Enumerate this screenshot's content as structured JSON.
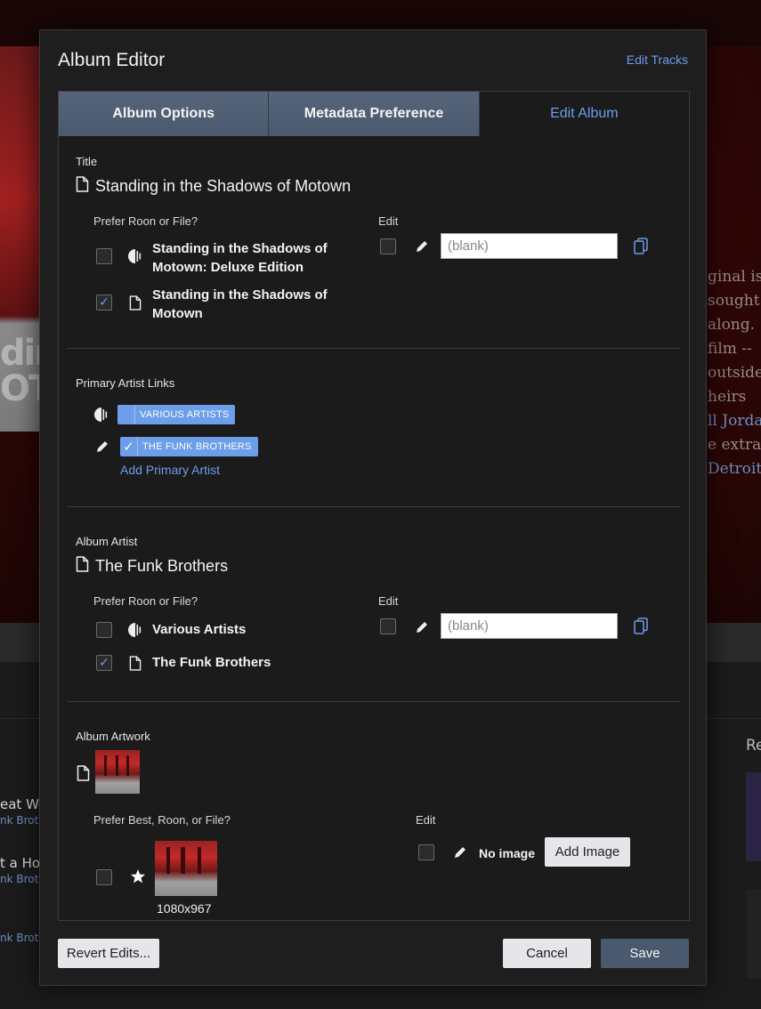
{
  "background": {
    "cover_text": "ding\nOT",
    "prose_lines": [
      "ginal is",
      "sought",
      "along.",
      "film --",
      "outside",
      "heirs",
      "ll Jorda",
      "e extra",
      "Detroit"
    ],
    "left_list": [
      {
        "title": "eat W",
        "subtitle": "nk Brot"
      },
      {
        "title": "t a Hol",
        "subtitle": "nk Brot"
      },
      {
        "title": "",
        "subtitle": "nk Brot"
      }
    ],
    "right_heading": "Re"
  },
  "dialog": {
    "title": "Album Editor",
    "edit_tracks_link": "Edit Tracks",
    "tabs": [
      {
        "label": "Album Options"
      },
      {
        "label": "Metadata Preference"
      },
      {
        "label": "Edit Album"
      }
    ],
    "active_tab": 2,
    "title_section": {
      "label": "Title",
      "value": "Standing in the Shadows of Motown",
      "prefer_label": "Prefer Roon or File?",
      "edit_label": "Edit",
      "options": [
        {
          "source": "roon",
          "line1": "Standing in the Shadows of",
          "line2": "Motown: Deluxe Edition",
          "checked": false
        },
        {
          "source": "file",
          "line1": "Standing in the Shadows of",
          "line2": "Motown",
          "checked": true
        }
      ],
      "edit_checked": false,
      "edit_placeholder": "(blank)"
    },
    "primary_artist": {
      "label": "Primary Artist Links",
      "chips": [
        {
          "source": "roon",
          "label": "VARIOUS ARTISTS",
          "checked": false
        },
        {
          "source": "edit",
          "label": "THE FUNK BROTHERS",
          "checked": true
        }
      ],
      "add_link": "Add Primary Artist"
    },
    "album_artist": {
      "label": "Album Artist",
      "value": "The Funk Brothers",
      "prefer_label": "Prefer Roon or File?",
      "edit_label": "Edit",
      "options": [
        {
          "source": "roon",
          "text": "Various Artists",
          "checked": false
        },
        {
          "source": "file",
          "text": "The Funk Brothers",
          "checked": true
        }
      ],
      "edit_checked": false,
      "edit_placeholder": "(blank)"
    },
    "artwork": {
      "label": "Album Artwork",
      "prefer_label": "Prefer Best, Roon, or File?",
      "edit_label": "Edit",
      "best_checked": false,
      "best_resolution": "1080x967",
      "edit_checked": false,
      "no_image_text": "No image",
      "add_image_button": "Add Image"
    },
    "footer": {
      "revert_button": "Revert Edits...",
      "cancel_button": "Cancel",
      "save_button": "Save"
    }
  },
  "colors": {
    "accent": "#6c9eea",
    "tab_bg": "#4f5e73",
    "dialog_bg": "#1e1e1f",
    "save_bg": "#4a596d"
  }
}
